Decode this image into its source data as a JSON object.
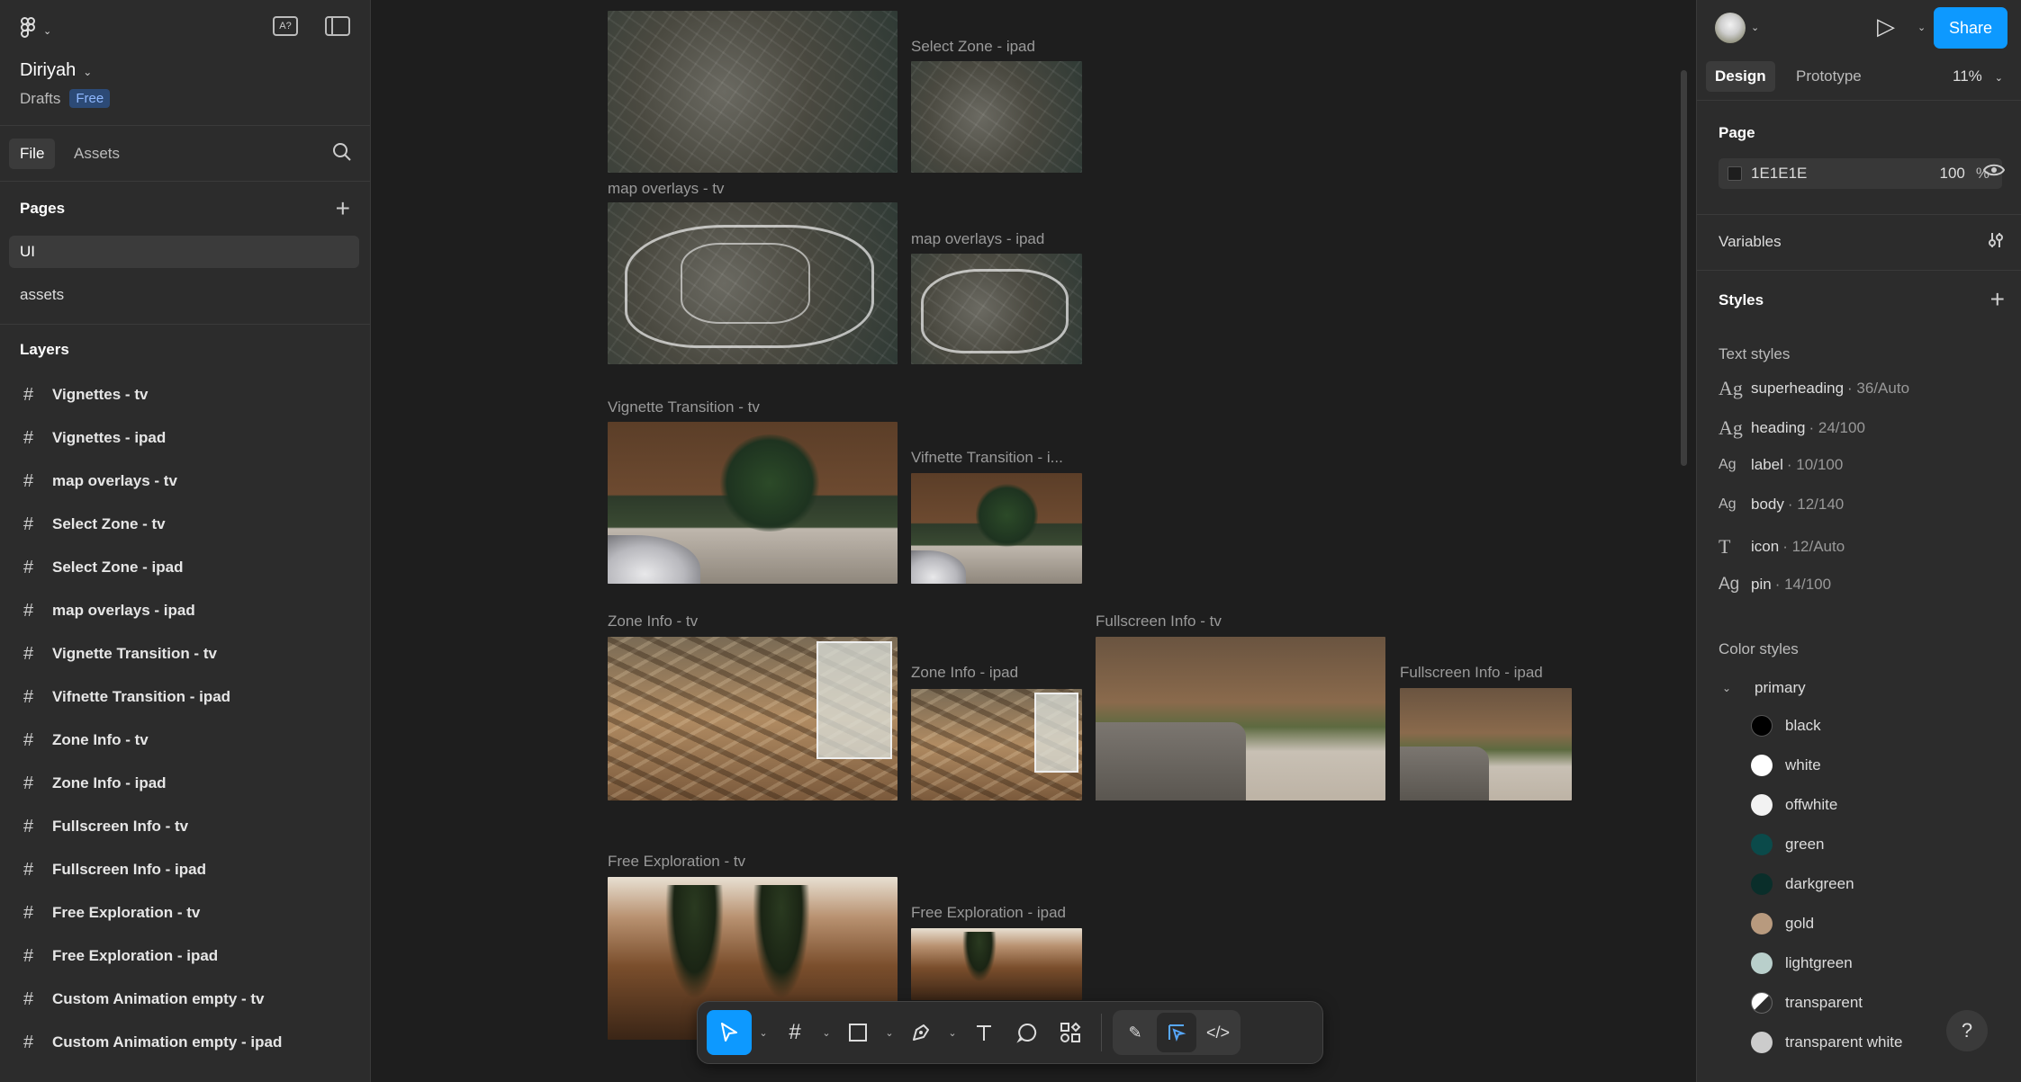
{
  "file": {
    "name": "Diriyah",
    "location": "Drafts",
    "plan_badge": "Free"
  },
  "left_tabs": {
    "file": "File",
    "assets": "Assets"
  },
  "pages": {
    "title": "Pages",
    "items": [
      "UI",
      "assets"
    ]
  },
  "layers": {
    "title": "Layers",
    "items": [
      "Vignettes - tv",
      "Vignettes - ipad",
      "map overlays - tv",
      "Select Zone - tv",
      "Select Zone - ipad",
      "map overlays - ipad",
      "Vignette Transition - tv",
      "Vifnette Transition - ipad",
      "Zone Info - tv",
      "Zone Info - ipad",
      "Fullscreen Info - tv",
      "Fullscreen Info - ipad",
      "Free Exploration - tv",
      "Free Exploration - ipad",
      "Custom Animation empty - tv",
      "Custom Animation empty - ipad"
    ]
  },
  "canvas": {
    "labels": {
      "select_zone_ipad": "Select Zone - ipad",
      "map_overlays_tv": "map overlays - tv",
      "map_overlays_ipad": "map overlays - ipad",
      "vignette_tv": "Vignette Transition - tv",
      "vignette_ipad": "Vifnette Transition - i...",
      "zone_info_tv": "Zone Info - tv",
      "zone_info_ipad": "Zone Info - ipad",
      "fullscreen_tv": "Fullscreen Info - tv",
      "fullscreen_ipad": "Fullscreen Info - ipad",
      "free_tv": "Free Exploration - tv",
      "free_ipad": "Free Exploration - ipad"
    }
  },
  "toolbar": {
    "tools": [
      "move-tool",
      "frame-tool",
      "shape-tool",
      "pen-tool",
      "text-tool",
      "comment-tool",
      "actions-tool",
      "draw-mode",
      "design-mode",
      "dev-mode"
    ]
  },
  "right": {
    "share": "Share",
    "tabs": {
      "design": "Design",
      "prototype": "Prototype"
    },
    "zoom": "11%",
    "page": {
      "title": "Page",
      "color": "1E1E1E",
      "opacity": "100",
      "percent": "%"
    },
    "variables": "Variables",
    "styles": "Styles",
    "text_styles_title": "Text styles",
    "text_styles": [
      {
        "name": "superheading",
        "meta": "· 36/Auto"
      },
      {
        "name": "heading",
        "meta": "· 24/100"
      },
      {
        "name": "label",
        "meta": "· 10/100"
      },
      {
        "name": "body",
        "meta": "· 12/140"
      },
      {
        "name": "icon",
        "meta": "· 12/Auto"
      },
      {
        "name": "pin",
        "meta": "· 14/100"
      }
    ],
    "color_styles_title": "Color styles",
    "color_group": "primary",
    "colors": [
      {
        "name": "black",
        "hex": "#000000"
      },
      {
        "name": "white",
        "hex": "#ffffff"
      },
      {
        "name": "offwhite",
        "hex": "#f2f2f2"
      },
      {
        "name": "green",
        "hex": "#0b4a4a"
      },
      {
        "name": "darkgreen",
        "hex": "#0a2e2a"
      },
      {
        "name": "gold",
        "hex": "#b89a7e"
      },
      {
        "name": "lightgreen",
        "hex": "#b9cfcb"
      },
      {
        "name": "transparent",
        "hex": "#ffffff"
      },
      {
        "name": "transparent white",
        "hex": "#cccccc"
      }
    ]
  }
}
